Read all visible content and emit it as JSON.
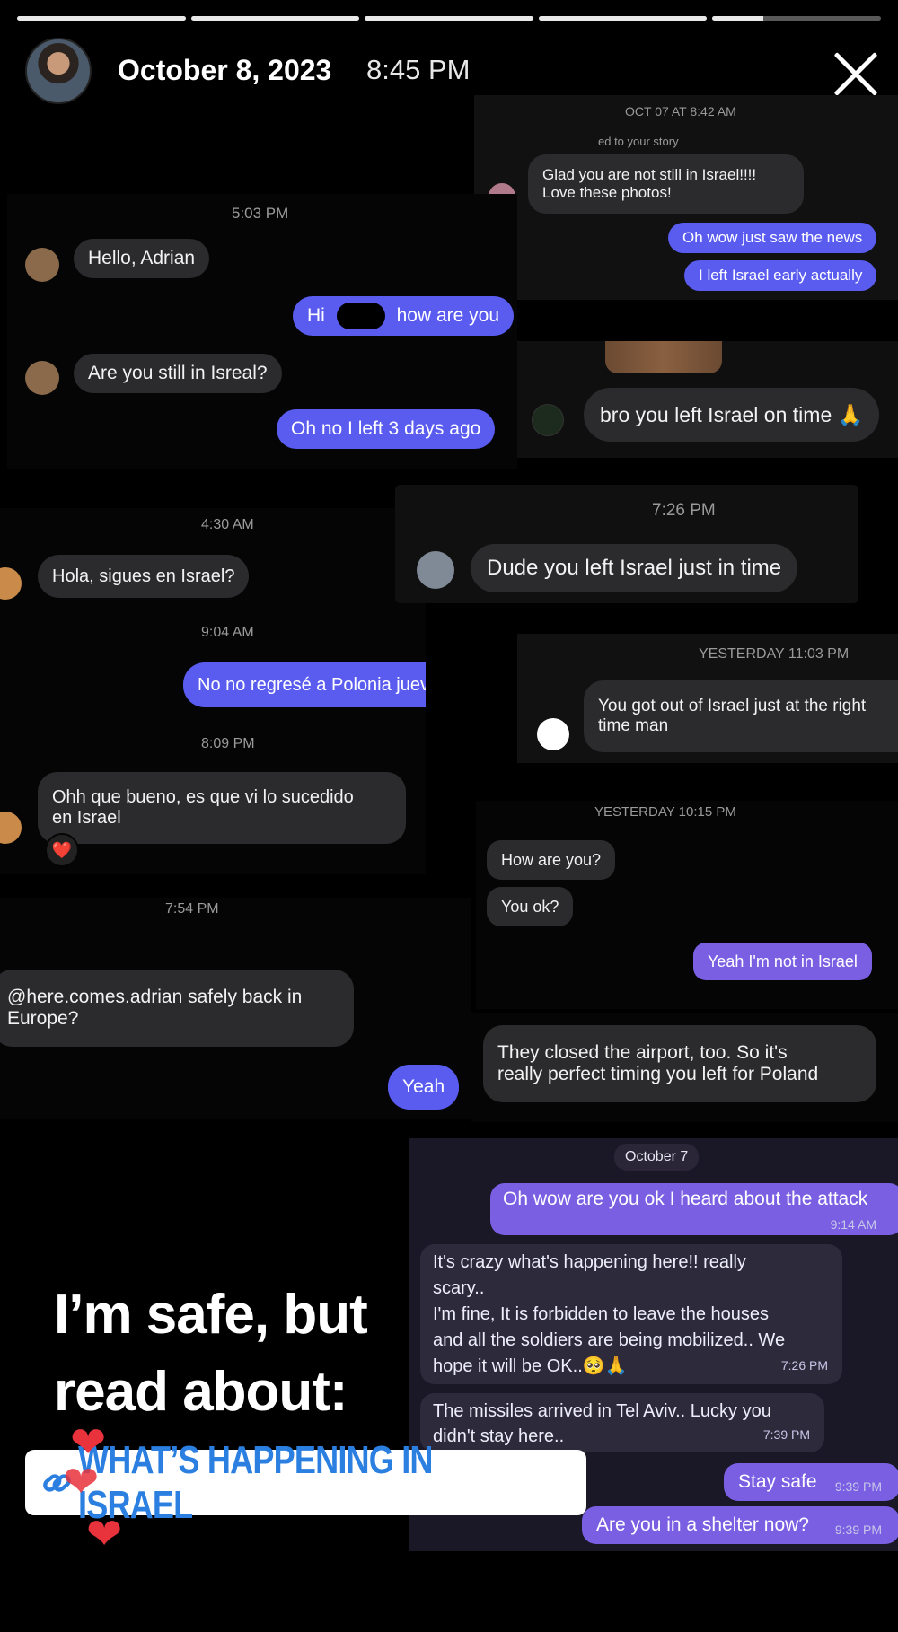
{
  "story": {
    "date": "October 8, 2023",
    "time": "8:45 PM",
    "progress_segments": [
      1,
      1,
      1,
      1,
      0.3
    ]
  },
  "panel_a": {
    "timestamp": "OCT 07 AT 8:42 AM",
    "reply_note": "ed to your story",
    "msg_in": "Glad you are not still in Israel!!!!",
    "msg_in_2": "Love these photos!",
    "msg_out_1": "Oh wow just saw the news",
    "msg_out_2": "I left Israel early actually"
  },
  "panel_b": {
    "timestamp": "5:03 PM",
    "msg_1": "Hello,  Adrian",
    "msg_2_left": "Hi",
    "msg_2_right": "how are you",
    "msg_3": "Are you still in Isreal?",
    "msg_4": "Oh no I left 3 days ago"
  },
  "panel_c": {
    "msg": "bro you left Israel on time 🙏"
  },
  "panel_d": {
    "ts_1": "4:30 AM",
    "msg_1": "Hola, sigues en Israel?",
    "ts_2": "9:04 AM",
    "msg_2": "No no regresé a Polonia jueves",
    "ts_3": "8:09 PM",
    "msg_3_line1": "Ohh que bueno, es que vi lo sucedido",
    "msg_3_line2": "en Israel",
    "reaction": "❤️"
  },
  "panel_e": {
    "timestamp": "7:26 PM",
    "msg": "Dude you left Israel just in time"
  },
  "panel_f": {
    "timestamp": "YESTERDAY 11:03 PM",
    "msg_line1": "You got out of Israel just at the right",
    "msg_line2": "time man"
  },
  "panel_g": {
    "timestamp": "YESTERDAY 10:15 PM",
    "msg_1": "How are you?",
    "msg_2": "You ok?",
    "msg_3": "Yeah I'm not  in Israel"
  },
  "panel_h": {
    "timestamp": "7:54 PM",
    "msg_line1": "@here.comes.adrian safely back in",
    "msg_line2": "Europe?",
    "reply": "Yeah"
  },
  "panel_i": {
    "msg_line1": "They closed the airport, too. So it's",
    "msg_line2": "really perfect timing you left for Poland"
  },
  "panel_j": {
    "date_chip": "October 7",
    "msg_1": "Oh wow are you ok I heard about the attack",
    "msg_1_time": "9:14 AM",
    "msg_2_line1": "It's crazy what's happening here!! really",
    "msg_2_line2": "scary..",
    "msg_2_line3": " I'm fine, It is forbidden to leave the houses",
    "msg_2_line4": "and all the soldiers are being mobilized.. We",
    "msg_2_line5": "hope it will be OK..🥺🙏",
    "msg_2_time": "7:26 PM",
    "msg_3_line1": "The missiles arrived in Tel Aviv.. Lucky you",
    "msg_3_line2": "didn't stay here..",
    "msg_3_time": "7:39 PM",
    "msg_4": "Stay safe",
    "msg_4_time": "9:39 PM",
    "msg_5": "Are you in a shelter now?",
    "msg_5_time": "9:39 PM"
  },
  "caption": {
    "line1": "I’m safe, but",
    "line2": "read about:"
  },
  "link_sticker": {
    "text": "WHAT’S HAPPENING IN ISRAEL"
  },
  "colors": {
    "accent_blue": "#5a5cf0",
    "telegram_purple": "#7a5fe3",
    "heart_red": "#e8323c",
    "link_blue": "#2a7fe0"
  }
}
